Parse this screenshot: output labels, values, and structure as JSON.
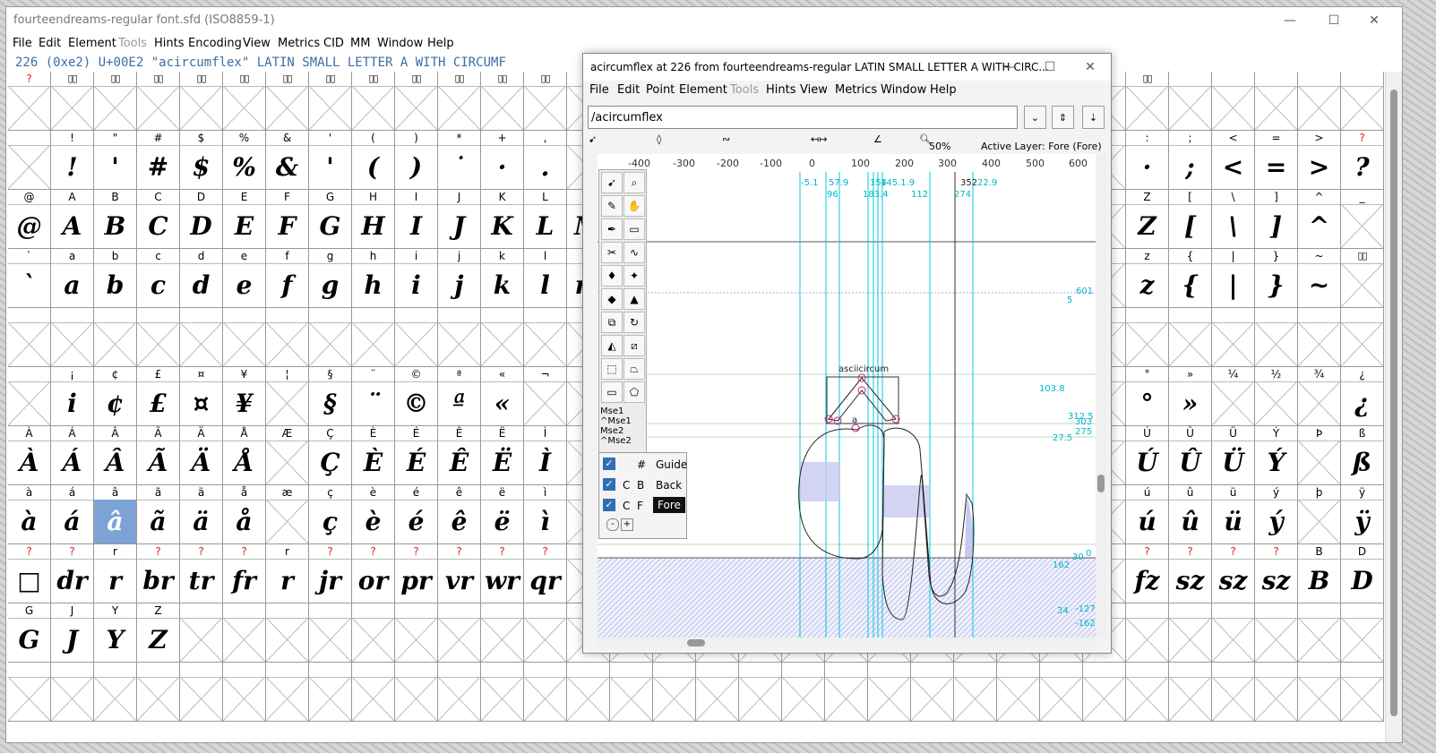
{
  "main": {
    "title": "fourteendreams-regular  font.sfd (ISO8859-1)",
    "menu": [
      "File",
      "Edit",
      "Element",
      "Tools",
      "Hints",
      "Encoding",
      "View",
      "Metrics",
      "CID",
      "MM",
      "Window",
      "Help"
    ],
    "info": "226 (0xe2) U+00E2 \"acircumflex\" LATIN SMALL LETTER A WITH CIRCUMF",
    "minimize": "—",
    "maximize": "☐",
    "close": "✕"
  },
  "grid": {
    "rows": [
      {
        "labels": [
          "?",
          "▯▯",
          "▯▯",
          "▯▯",
          "▯▯",
          "▯▯",
          "▯▯",
          "▯▯",
          "▯▯",
          "▯▯",
          "▯▯",
          "▯▯",
          "▯▯",
          "▯▯",
          "",
          "",
          "",
          "",
          "",
          "",
          "",
          "",
          "",
          "",
          "",
          "",
          "▯▯",
          "",
          "",
          "",
          "",
          "",
          ""
        ],
        "glyphs": [
          "",
          "",
          "",
          "",
          "",
          "",
          "",
          "",
          "",
          "",
          "",
          "",
          "",
          "",
          "",
          "",
          "",
          "",
          "",
          "",
          "",
          "",
          "",
          "",
          "",
          "",
          "",
          "",
          "",
          "",
          "",
          "",
          ""
        ],
        "empty": [
          true,
          true,
          true,
          true,
          true,
          true,
          true,
          true,
          true,
          true,
          true,
          true,
          true,
          true,
          true,
          true,
          true,
          true,
          true,
          true,
          true,
          true,
          true,
          true,
          true,
          true,
          true,
          true,
          true,
          true,
          true,
          true
        ]
      },
      {
        "labels": [
          "",
          "!",
          "\"",
          "#",
          "$",
          "%",
          "&",
          "'",
          "(",
          ")",
          "*",
          "+",
          ",",
          "",
          "",
          "",
          "",
          "",
          "",
          "",
          "",
          "",
          "",
          "",
          "",
          "",
          ":",
          ";",
          "<",
          "=",
          ">",
          "?",
          ""
        ],
        "glyphs": [
          "",
          "!",
          "'",
          "#",
          "$",
          "%",
          "&",
          "'",
          "(",
          ")",
          "˙",
          "·",
          ".",
          "",
          "",
          "",
          "",
          "",
          "",
          "",
          "",
          "",
          "",
          "",
          "",
          "",
          "·",
          ";",
          "<",
          "=",
          ">",
          "?",
          ""
        ],
        "empty": [
          true,
          false,
          false,
          false,
          false,
          false,
          false,
          false,
          false,
          false,
          false,
          false,
          false,
          true,
          true,
          true,
          true,
          true,
          true,
          true,
          true,
          true,
          true,
          true,
          true,
          true,
          false,
          false,
          false,
          false,
          false,
          false,
          true
        ]
      },
      {
        "labels": [
          "@",
          "A",
          "B",
          "C",
          "D",
          "E",
          "F",
          "G",
          "H",
          "I",
          "J",
          "K",
          "L",
          "M",
          "",
          "",
          "",
          "",
          "",
          "",
          "",
          "",
          "",
          "",
          "",
          "",
          "Z",
          "[",
          "\\",
          "]",
          "^",
          "_",
          ""
        ],
        "glyphs": [
          "@",
          "A",
          "B",
          "C",
          "D",
          "E",
          "F",
          "G",
          "H",
          "I",
          "J",
          "K",
          "L",
          "M",
          "",
          "",
          "",
          "",
          "",
          "",
          "",
          "",
          "",
          "",
          "",
          "",
          "Z",
          "[",
          "\\",
          "]",
          "^",
          "",
          ""
        ],
        "empty": [
          false,
          false,
          false,
          false,
          false,
          false,
          false,
          false,
          false,
          false,
          false,
          false,
          false,
          false,
          true,
          true,
          true,
          true,
          true,
          true,
          true,
          true,
          true,
          true,
          true,
          true,
          false,
          false,
          false,
          false,
          false,
          true,
          true
        ]
      },
      {
        "labels": [
          "`",
          "a",
          "b",
          "c",
          "d",
          "e",
          "f",
          "g",
          "h",
          "i",
          "j",
          "k",
          "l",
          "m",
          "",
          "",
          "",
          "",
          "",
          "",
          "",
          "",
          "",
          "",
          "",
          "",
          "z",
          "{",
          "|",
          "}",
          "~",
          "▯▯",
          ""
        ],
        "glyphs": [
          "`",
          "a",
          "b",
          "c",
          "d",
          "e",
          "f",
          "g",
          "h",
          "i",
          "j",
          "k",
          "l",
          "m",
          "",
          "",
          "",
          "",
          "",
          "",
          "",
          "",
          "",
          "",
          "",
          "",
          "z",
          "{",
          "|",
          "}",
          "~",
          "",
          ""
        ],
        "empty": [
          false,
          false,
          false,
          false,
          false,
          false,
          false,
          false,
          false,
          false,
          false,
          false,
          false,
          false,
          true,
          true,
          true,
          true,
          true,
          true,
          true,
          true,
          true,
          true,
          true,
          true,
          false,
          false,
          false,
          false,
          false,
          true,
          true
        ]
      },
      {
        "labels": [
          "",
          "",
          "",
          "",
          "",
          "",
          "",
          "",
          "",
          "",
          "",
          "",
          "",
          "",
          "",
          "",
          "",
          "",
          "",
          "",
          "",
          "",
          "",
          "",
          "",
          "",
          "",
          "",
          "",
          "",
          "",
          "",
          ""
        ],
        "glyphs": [
          "",
          "",
          "",
          "",
          "",
          "",
          "",
          "",
          "",
          "",
          "",
          "",
          "",
          "",
          "",
          "",
          "",
          "",
          "",
          "",
          "",
          "",
          "",
          "",
          "",
          "",
          "",
          "",
          "",
          "",
          "",
          "",
          ""
        ],
        "empty": [
          true,
          true,
          true,
          true,
          true,
          true,
          true,
          true,
          true,
          true,
          true,
          true,
          true,
          true,
          true,
          true,
          true,
          true,
          true,
          true,
          true,
          true,
          true,
          true,
          true,
          true,
          true,
          true,
          true,
          true,
          true,
          true,
          true
        ]
      },
      {
        "labels": [
          "",
          "¡",
          "¢",
          "£",
          "¤",
          "¥",
          "¦",
          "§",
          "¨",
          "©",
          "ª",
          "«",
          "¬",
          "",
          "",
          "",
          "",
          "",
          "",
          "",
          "",
          "",
          "",
          "",
          "",
          "",
          "°",
          "»",
          "¼",
          "½",
          "¾",
          "¿",
          ""
        ],
        "glyphs": [
          "",
          "i",
          "¢",
          "£",
          "¤",
          "¥",
          "",
          "§",
          "¨",
          "©",
          "ª",
          "«",
          "",
          "",
          "",
          "",
          "",
          "",
          "",
          "",
          "",
          "",
          "",
          "",
          "",
          "",
          "°",
          "»",
          "",
          "",
          "",
          "¿",
          ""
        ],
        "empty": [
          true,
          false,
          false,
          false,
          false,
          false,
          true,
          false,
          false,
          false,
          false,
          false,
          true,
          true,
          true,
          true,
          true,
          true,
          true,
          true,
          true,
          true,
          true,
          true,
          true,
          true,
          false,
          false,
          true,
          true,
          true,
          false,
          true
        ]
      },
      {
        "labels": [
          "À",
          "Á",
          "Â",
          "Ã",
          "Ä",
          "Å",
          "Æ",
          "Ç",
          "È",
          "É",
          "Ê",
          "Ë",
          "Ì",
          "",
          "",
          "",
          "",
          "",
          "",
          "",
          "",
          "",
          "",
          "",
          "",
          "",
          "Ú",
          "Û",
          "Ü",
          "Ý",
          "Þ",
          "ß",
          ""
        ],
        "glyphs": [
          "À",
          "Á",
          "Â",
          "Ã",
          "Ä",
          "Å",
          "",
          "Ç",
          "È",
          "É",
          "Ê",
          "Ë",
          "Ì",
          "",
          "",
          "",
          "",
          "",
          "",
          "",
          "",
          "",
          "",
          "",
          "",
          "",
          "Ú",
          "Û",
          "Ü",
          "Ý",
          "",
          "ß",
          ""
        ],
        "empty": [
          false,
          false,
          false,
          false,
          false,
          false,
          true,
          false,
          false,
          false,
          false,
          false,
          false,
          true,
          true,
          true,
          true,
          true,
          true,
          true,
          true,
          true,
          true,
          true,
          true,
          true,
          false,
          false,
          false,
          false,
          true,
          false,
          true
        ]
      },
      {
        "labels": [
          "à",
          "á",
          "â",
          "ã",
          "ä",
          "å",
          "æ",
          "ç",
          "è",
          "é",
          "ê",
          "ë",
          "ì",
          "",
          "",
          "",
          "",
          "",
          "",
          "",
          "",
          "",
          "",
          "",
          "",
          "",
          "ú",
          "û",
          "ü",
          "ý",
          "þ",
          "ÿ",
          ""
        ],
        "glyphs": [
          "à",
          "á",
          "â",
          "ã",
          "ä",
          "å",
          "",
          "ç",
          "è",
          "é",
          "ê",
          "ë",
          "ì",
          "",
          "",
          "",
          "",
          "",
          "",
          "",
          "",
          "",
          "",
          "",
          "",
          "",
          "ú",
          "û",
          "ü",
          "ý",
          "",
          "ÿ",
          ""
        ],
        "empty": [
          false,
          false,
          false,
          false,
          false,
          false,
          true,
          false,
          false,
          false,
          false,
          false,
          false,
          true,
          true,
          true,
          true,
          true,
          true,
          true,
          true,
          true,
          true,
          true,
          true,
          true,
          false,
          false,
          false,
          false,
          true,
          false,
          true
        ]
      },
      {
        "labels": [
          "?",
          "?",
          "r",
          "?",
          "?",
          "?",
          "r",
          "?",
          "?",
          "?",
          "?",
          "?",
          "?",
          "",
          "",
          "",
          "",
          "",
          "",
          "",
          "",
          "",
          "",
          "",
          "",
          "",
          "?",
          "?",
          "?",
          "?",
          "B",
          "D",
          ""
        ],
        "glyphs": [
          "□",
          "dr",
          "r",
          "br",
          "tr",
          "fr",
          "r",
          "jr",
          "or",
          "pr",
          "vr",
          "wr",
          "qr",
          "",
          "",
          "",
          "",
          "",
          "",
          "",
          "",
          "",
          "",
          "",
          "",
          "",
          "fz",
          "sz",
          "sz",
          "sz",
          "B",
          "D",
          ""
        ],
        "empty": [
          false,
          false,
          false,
          false,
          false,
          false,
          false,
          false,
          false,
          false,
          false,
          false,
          false,
          true,
          true,
          true,
          true,
          true,
          true,
          true,
          true,
          true,
          true,
          true,
          true,
          true,
          false,
          false,
          false,
          false,
          false,
          false,
          true
        ]
      },
      {
        "labels": [
          "G",
          "J",
          "Y",
          "Z",
          "",
          "",
          "",
          "",
          "",
          "",
          "",
          "",
          "",
          "",
          "",
          "",
          "",
          "",
          "",
          "",
          "",
          "",
          "",
          "",
          "",
          "",
          "",
          "",
          "",
          "",
          "",
          "",
          ""
        ],
        "glyphs": [
          "G",
          "J",
          "Y",
          "Z",
          "",
          "",
          "",
          "",
          "",
          "",
          "",
          "",
          "",
          "",
          "",
          "",
          "",
          "",
          "",
          "",
          "",
          "",
          "",
          "",
          "",
          "",
          "",
          "",
          "",
          "",
          "",
          "",
          ""
        ],
        "empty": [
          false,
          false,
          false,
          false,
          true,
          true,
          true,
          true,
          true,
          true,
          true,
          true,
          true,
          true,
          true,
          true,
          true,
          true,
          true,
          true,
          true,
          true,
          true,
          true,
          true,
          true,
          true,
          true,
          true,
          true,
          true,
          true,
          true
        ]
      },
      {
        "labels": [
          "",
          "",
          "",
          "",
          "",
          "",
          "",
          "",
          "",
          "",
          "",
          "",
          "",
          "",
          "",
          "",
          "",
          "",
          "",
          "",
          "",
          "",
          "",
          "",
          "",
          "",
          "",
          "",
          "",
          "",
          "",
          "",
          ""
        ],
        "glyphs": [
          "",
          "",
          "",
          "",
          "",
          "",
          "",
          "",
          "",
          "",
          "",
          "",
          "",
          "",
          "",
          "",
          "",
          "",
          "",
          "",
          "",
          "",
          "",
          "",
          "",
          "",
          "",
          "",
          "",
          "",
          "",
          "",
          ""
        ],
        "empty": [
          true,
          true,
          true,
          true,
          true,
          true,
          true,
          true,
          true,
          true,
          true,
          true,
          true,
          true,
          true,
          true,
          true,
          true,
          true,
          true,
          true,
          true,
          true,
          true,
          true,
          true,
          true,
          true,
          true,
          true,
          true,
          true,
          true
        ]
      }
    ],
    "selected": {
      "row": 7,
      "col": 2
    }
  },
  "glyph_window": {
    "title": "acircumflex at 226 from fourteendreams-regular LATIN SMALL LETTER A WITH CIRC...",
    "menu": [
      "File",
      "Edit",
      "Point",
      "Element",
      "Tools",
      "Hints",
      "View",
      "Metrics",
      "Window",
      "Help"
    ],
    "name_field": "/acircumflex",
    "zoom": "50%",
    "active_layer": "Active Layer: Fore (Fore)",
    "ruler_ticks": [
      "-400",
      "-300",
      "-200",
      "-100",
      "0",
      "100",
      "200",
      "300",
      "400",
      "500",
      "600"
    ],
    "canvas_labels": {
      "top": [
        "-5.1",
        "57.9",
        "154",
        "145.1.9",
        "352",
        "22.9",
        "96",
        "183.4",
        "112",
        "274"
      ],
      "right": [
        "601",
        "5",
        "103.8",
        "312.5",
        "303",
        "275",
        "27.5",
        "0",
        "30",
        "162",
        "-127",
        "34",
        "-162"
      ],
      "anchor_name": "asciicircum",
      "a_label": "a"
    },
    "mouse_labels": [
      "Mse1",
      "^Mse1",
      "Mse2",
      "^Mse2"
    ],
    "layers": [
      {
        "flags": [
          "#"
        ],
        "name": "Guide"
      },
      {
        "flags": [
          "C",
          "B"
        ],
        "name": "Back"
      },
      {
        "flags": [
          "C",
          "F"
        ],
        "name": "Fore"
      }
    ],
    "layer_buttons": [
      "-",
      "+"
    ],
    "minimize": "—",
    "maximize": "☐",
    "close": "✕"
  },
  "colors": {
    "selection": "#7da3d6",
    "guide": "#00c8e0",
    "point": "#cc2288",
    "ref_fill": "#c8c8f0"
  }
}
